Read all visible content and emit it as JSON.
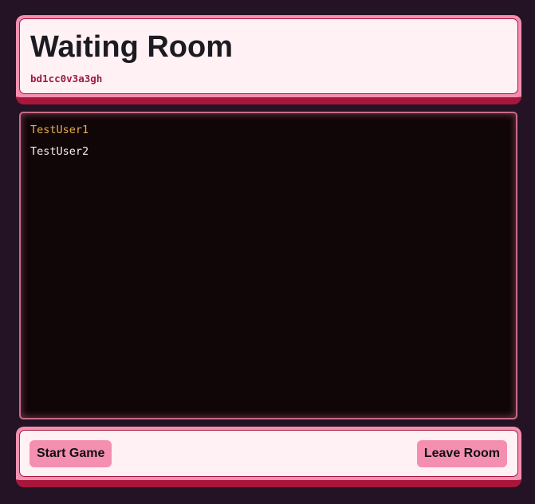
{
  "header": {
    "title": "Waiting Room",
    "room_code": "bd1cc0v3a3gh"
  },
  "players": [
    {
      "name": "TestUser1",
      "role": "host",
      "color": "#e8b04a"
    },
    {
      "name": "TestUser2",
      "role": "player",
      "color": "#f5f0f2"
    }
  ],
  "footer": {
    "start_label": "Start Game",
    "leave_label": "Leave Room"
  },
  "colors": {
    "background": "#231325",
    "accent": "#f48fb1",
    "accent_dark": "#a8163c",
    "card": "#fff1f4",
    "panel": "#100507"
  }
}
